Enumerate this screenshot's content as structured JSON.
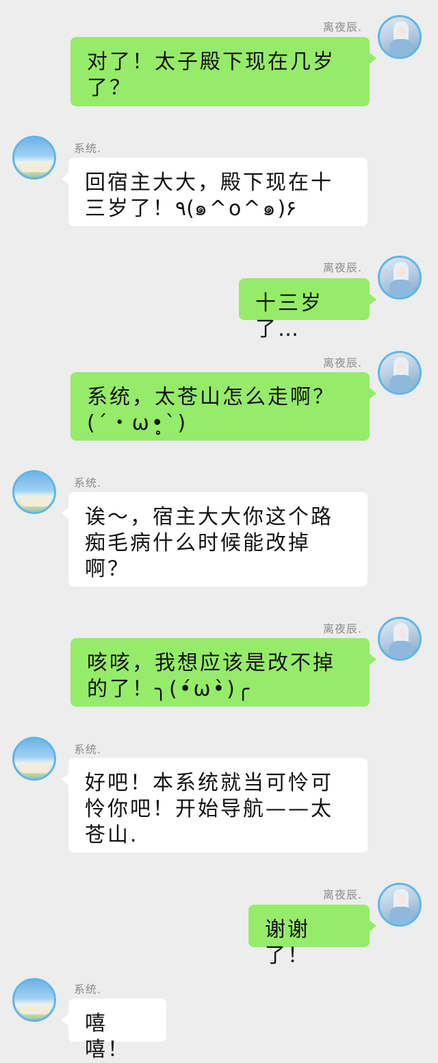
{
  "chat": {
    "user_name": "离夜辰.",
    "system_name": "系统.",
    "messages": [
      {
        "from": "user",
        "text": "对了！太子殿下现在几岁\n了？"
      },
      {
        "from": "system",
        "text": "回宿主大大，殿下现在十\n三岁了！٩(๑^o^๑)۶"
      },
      {
        "from": "user",
        "text": "十三岁了…"
      },
      {
        "from": "user",
        "text": "系统，太苍山怎么走啊？\n(´・ω•̥`)"
      },
      {
        "from": "system",
        "text": "诶～，宿主大大你这个路\n痴毛病什么时候能改掉\n啊？"
      },
      {
        "from": "user",
        "text": "咳咳，我想应该是改不掉\n的了！╮(•́ω•̀)╭"
      },
      {
        "from": "system",
        "text": "好吧！本系统就当可怜可\n怜你吧！开始导航——太\n苍山."
      },
      {
        "from": "user",
        "text": "谢谢了！"
      },
      {
        "from": "system",
        "text": "嘻嘻！"
      }
    ]
  }
}
